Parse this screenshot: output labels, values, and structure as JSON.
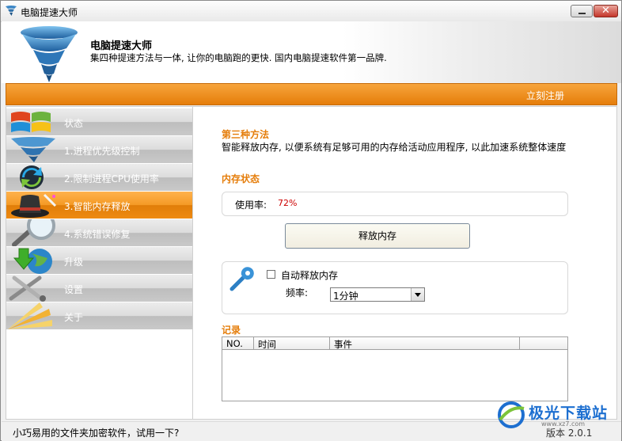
{
  "window": {
    "title": "电脑提速大师"
  },
  "header": {
    "app_name": "电脑提速大师",
    "slogan": "集四种提速方法与一体, 让你的电脑跑的更快. 国内电脑提速软件第一品牌."
  },
  "top_bar": {
    "register_label": "立刻注册"
  },
  "sidebar": {
    "items": [
      {
        "label": "状态",
        "icon": "windows-logo-icon",
        "active": false
      },
      {
        "label": "1.进程优先级控制",
        "icon": "tornado-icon",
        "active": false
      },
      {
        "label": "2.限制进程CPU使用率",
        "icon": "refresh-arrows-icon",
        "active": false
      },
      {
        "label": "3.智能内存释放",
        "icon": "magic-hat-icon",
        "active": true
      },
      {
        "label": "4.系统错误修复",
        "icon": "magnifier-icon",
        "active": false
      },
      {
        "label": "升级",
        "icon": "globe-download-icon",
        "active": false
      },
      {
        "label": "设置",
        "icon": "tools-icon",
        "active": false
      },
      {
        "label": "关于",
        "icon": "light-burst-icon",
        "active": false
      }
    ]
  },
  "main": {
    "method_title": "第三种方法",
    "method_desc": "智能释放内存, 以便系统有足够可用的内存给活动应用程序, 以此加速系统整体速度",
    "memory_status_title": "内存状态",
    "usage_label": "使用率:",
    "usage_value": "72%",
    "release_button": "释放内存",
    "auto_release_label": "自动释放内存",
    "auto_release_checked": false,
    "frequency_label": "频率:",
    "frequency_value": "1分钟",
    "log_title": "记录",
    "log_columns": [
      "NO.",
      "时间",
      "事件",
      ""
    ]
  },
  "status_bar": {
    "tip": "小巧易用的文件夹加密软件，试用一下?",
    "version": "版本 2.0.1"
  },
  "watermark": {
    "text": "极光下载站",
    "url": "www.xz7.com"
  },
  "colors": {
    "accent": "#e57d0a",
    "usage_value": "#cc0000"
  }
}
